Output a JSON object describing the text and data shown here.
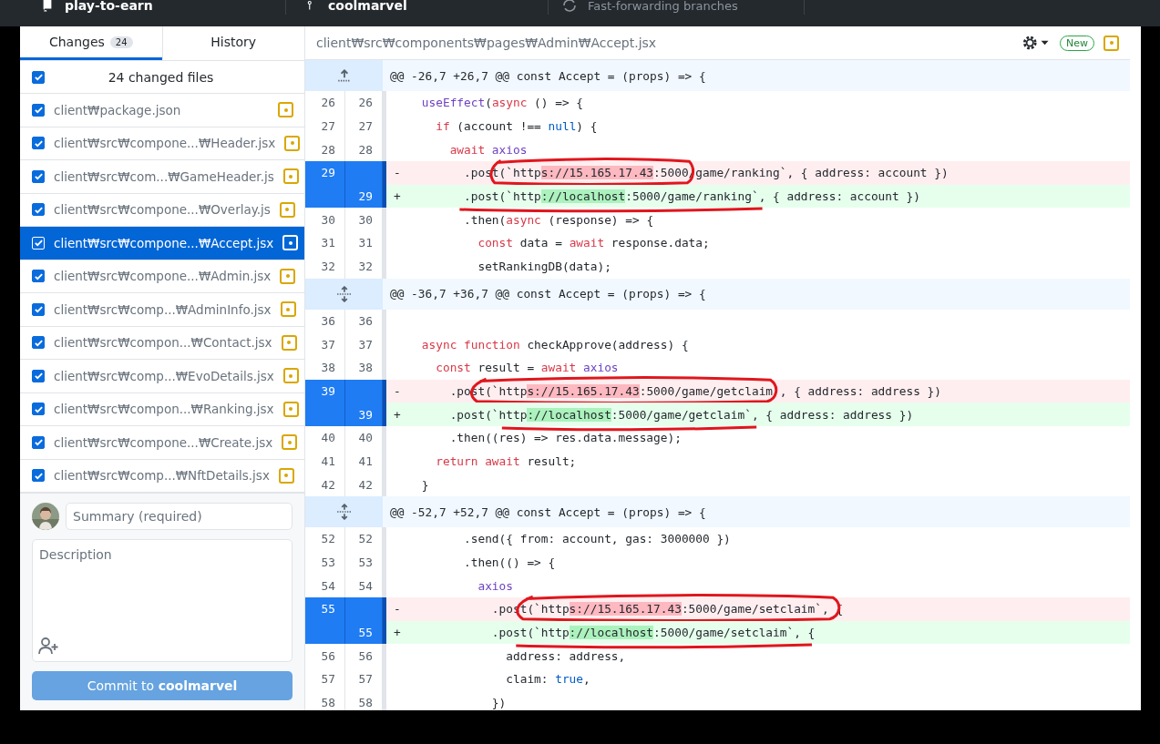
{
  "toolbar": {
    "repository": "play-to-earn",
    "branch": "coolmarvel",
    "status": "Fast-forwarding branches"
  },
  "tabs": [
    {
      "label": "Changes",
      "count": "24",
      "selected": true
    },
    {
      "label": "History",
      "selected": false
    }
  ],
  "changes": {
    "summary": "24 changed files",
    "all_checked": true,
    "files": [
      {
        "path": "client₩package.json",
        "checked": true,
        "selected": false,
        "modified": true
      },
      {
        "path": "client₩src₩compone...₩Header.jsx",
        "checked": true,
        "selected": false,
        "modified": true
      },
      {
        "path": "client₩src₩com...₩GameHeader.js",
        "checked": true,
        "selected": false,
        "modified": true
      },
      {
        "path": "client₩src₩compone...₩Overlay.js",
        "checked": true,
        "selected": false,
        "modified": true
      },
      {
        "path": "client₩src₩compone...₩Accept.jsx",
        "checked": true,
        "selected": true,
        "modified": true
      },
      {
        "path": "client₩src₩compone...₩Admin.jsx",
        "checked": true,
        "selected": false,
        "modified": true
      },
      {
        "path": "client₩src₩comp...₩AdminInfo.jsx",
        "checked": true,
        "selected": false,
        "modified": true
      },
      {
        "path": "client₩src₩compon...₩Contact.jsx",
        "checked": true,
        "selected": false,
        "modified": true
      },
      {
        "path": "client₩src₩comp...₩EvoDetails.jsx",
        "checked": true,
        "selected": false,
        "modified": true
      },
      {
        "path": "client₩src₩compon...₩Ranking.jsx",
        "checked": true,
        "selected": false,
        "modified": true
      },
      {
        "path": "client₩src₩compone...₩Create.jsx",
        "checked": true,
        "selected": false,
        "modified": true
      },
      {
        "path": "client₩src₩comp...₩NftDetails.jsx",
        "checked": true,
        "selected": false,
        "modified": true
      }
    ]
  },
  "commit": {
    "summary": {
      "placeholder": "Summary (required)"
    },
    "description": {
      "placeholder": "Description"
    },
    "button": "Commit to **coolmarvel**",
    "button_disabled": true
  },
  "diff": {
    "path": "client₩src₩components₩pages₩Admin₩Accept.jsx",
    "badge": "New",
    "modified": true,
    "hunks": [
      {
        "header": "@@ -26,7 +26,7 @@ const Accept = (props) => {",
        "kind": "up",
        "lines": [
          {
            "kind": "context",
            "old": "26",
            "new": "26",
            "code": [
              {
                "kind": "function",
                "text": "  useEffect"
              },
              {
                "kind": "plain",
                "text": "("
              },
              {
                "kind": "keyword",
                "text": "async"
              },
              {
                "kind": "plain",
                "text": " () => {"
              }
            ]
          },
          {
            "kind": "context",
            "old": "27",
            "new": "27",
            "code": [
              {
                "kind": "keyword",
                "text": "    if"
              },
              {
                "kind": "plain",
                "text": " (account !== "
              },
              {
                "kind": "constant",
                "text": "null"
              },
              {
                "kind": "plain",
                "text": ") {"
              }
            ]
          },
          {
            "kind": "context",
            "old": "28",
            "new": "28",
            "code": [
              {
                "kind": "keyword",
                "text": "      await"
              },
              {
                "kind": "function",
                "text": " axios"
              }
            ]
          },
          {
            "kind": "deleted",
            "old": "29",
            "marker": "-",
            "code": [
              {
                "kind": "plain",
                "text": "        .post(`http"
              },
              {
                "kind": "removed",
                "text": "s://15.165.17.43"
              },
              {
                "kind": "plain",
                "text": ":5000/game/ranking`, { address: account })"
              }
            ]
          },
          {
            "kind": "added",
            "new": "29",
            "marker": "+",
            "code": [
              {
                "kind": "plain",
                "text": "        .post(`http"
              },
              {
                "kind": "inserted",
                "text": "://localhost"
              },
              {
                "kind": "plain",
                "text": ":5000/game/ranking`, { address: account })"
              }
            ]
          },
          {
            "kind": "context",
            "old": "30",
            "new": "30",
            "code": [
              {
                "kind": "plain",
                "text": "        .then("
              },
              {
                "kind": "keyword",
                "text": "async"
              },
              {
                "kind": "plain",
                "text": " (response) => {"
              }
            ]
          },
          {
            "kind": "context",
            "old": "31",
            "new": "31",
            "code": [
              {
                "kind": "keyword",
                "text": "          const"
              },
              {
                "kind": "plain",
                "text": " data = "
              },
              {
                "kind": "keyword",
                "text": "await"
              },
              {
                "kind": "plain",
                "text": " response.data;"
              }
            ]
          },
          {
            "kind": "context",
            "old": "32",
            "new": "32",
            "code": [
              {
                "kind": "plain",
                "text": "          setRankingDB(data);"
              }
            ]
          }
        ]
      },
      {
        "header": "@@ -36,7 +36,7 @@ const Accept = (props) => {",
        "kind": "both",
        "lines": [
          {
            "kind": "context",
            "old": "36",
            "new": "36"
          },
          {
            "kind": "context",
            "old": "37",
            "new": "37",
            "code": [
              {
                "kind": "keyword",
                "text": "  async"
              },
              {
                "kind": "keyword",
                "text": " function"
              },
              {
                "kind": "plain",
                "text": " checkApprove(address) {"
              }
            ]
          },
          {
            "kind": "context",
            "old": "38",
            "new": "38",
            "code": [
              {
                "kind": "keyword",
                "text": "    const"
              },
              {
                "kind": "plain",
                "text": " result = "
              },
              {
                "kind": "keyword",
                "text": "await"
              },
              {
                "kind": "function",
                "text": " axios"
              }
            ]
          },
          {
            "kind": "deleted",
            "old": "39",
            "marker": "-",
            "code": [
              {
                "kind": "plain",
                "text": "      .post(`http"
              },
              {
                "kind": "removed",
                "text": "s://15.165.17.43"
              },
              {
                "kind": "plain",
                "text": ":5000/game/getclaim`, { address: address })"
              }
            ]
          },
          {
            "kind": "added",
            "new": "39",
            "marker": "+",
            "code": [
              {
                "kind": "plain",
                "text": "      .post(`http"
              },
              {
                "kind": "inserted",
                "text": "://localhost"
              },
              {
                "kind": "plain",
                "text": ":5000/game/getclaim`, { address: address })"
              }
            ]
          },
          {
            "kind": "context",
            "old": "40",
            "new": "40",
            "code": [
              {
                "kind": "plain",
                "text": "      .then((res) => res.data.message);"
              }
            ]
          },
          {
            "kind": "context",
            "old": "41",
            "new": "41",
            "code": [
              {
                "kind": "keyword",
                "text": "    return"
              },
              {
                "kind": "keyword",
                "text": " await"
              },
              {
                "kind": "plain",
                "text": " result;"
              }
            ]
          },
          {
            "kind": "context",
            "old": "42",
            "new": "42",
            "code": [
              {
                "kind": "plain",
                "text": "  }"
              }
            ]
          }
        ]
      },
      {
        "header": "@@ -52,7 +52,7 @@ const Accept = (props) => {",
        "kind": "both",
        "lines": [
          {
            "kind": "context",
            "old": "52",
            "new": "52",
            "code": [
              {
                "kind": "plain",
                "text": "        .send({ from: account, gas: 3000000 })"
              }
            ]
          },
          {
            "kind": "context",
            "old": "53",
            "new": "53",
            "code": [
              {
                "kind": "plain",
                "text": "        .then(() => {"
              }
            ]
          },
          {
            "kind": "context",
            "old": "54",
            "new": "54",
            "code": [
              {
                "kind": "function",
                "text": "          axios"
              }
            ]
          },
          {
            "kind": "deleted",
            "old": "55",
            "marker": "-",
            "code": [
              {
                "kind": "plain",
                "text": "            .post(`http"
              },
              {
                "kind": "removed",
                "text": "s://15.165.17.43"
              },
              {
                "kind": "plain",
                "text": ":5000/game/setclaim`, {"
              }
            ]
          },
          {
            "kind": "added",
            "new": "55",
            "marker": "+",
            "code": [
              {
                "kind": "plain",
                "text": "            .post(`http"
              },
              {
                "kind": "inserted",
                "text": "://localhost"
              },
              {
                "kind": "plain",
                "text": ":5000/game/setclaim`, {"
              }
            ]
          },
          {
            "kind": "context",
            "old": "56",
            "new": "56",
            "code": [
              {
                "kind": "plain",
                "text": "              address: address,"
              }
            ]
          },
          {
            "kind": "context",
            "old": "57",
            "new": "57",
            "code": [
              {
                "kind": "plain",
                "text": "              claim: "
              },
              {
                "kind": "constant",
                "text": "true"
              },
              {
                "kind": "plain",
                "text": ","
              }
            ]
          },
          {
            "kind": "context",
            "old": "58",
            "new": "58",
            "code": [
              {
                "kind": "plain",
                "text": "            })"
              }
            ]
          }
        ]
      }
    ]
  }
}
